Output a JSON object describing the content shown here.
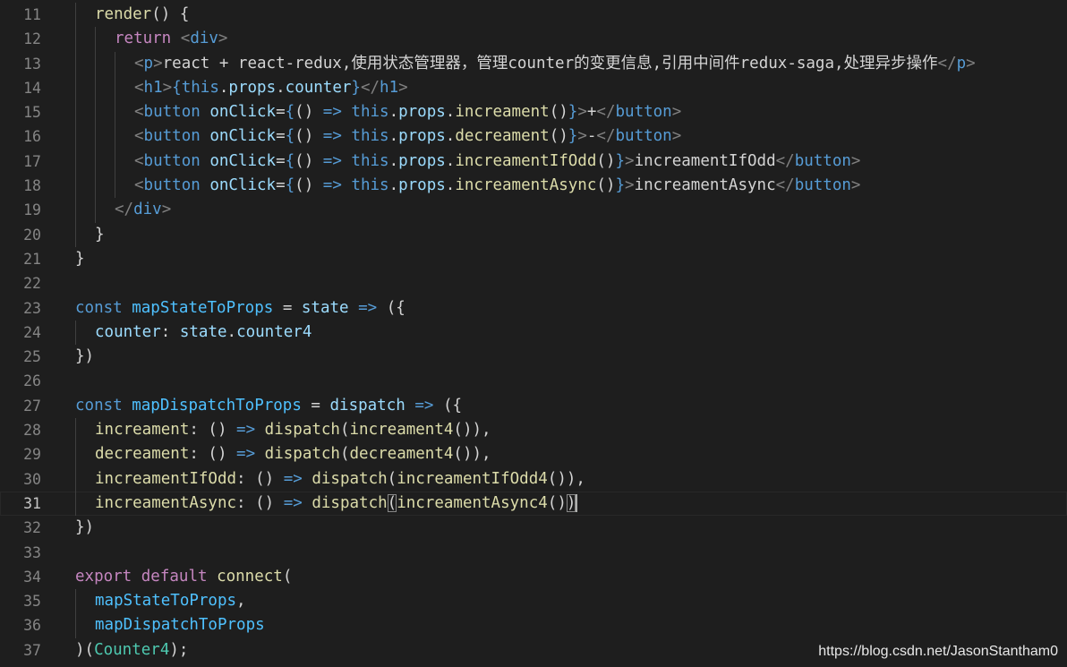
{
  "editor": {
    "lines": [
      {
        "n": "11",
        "indent": 1,
        "tokens": [
          [
            "fn",
            "render"
          ],
          [
            "op",
            "() {"
          ]
        ]
      },
      {
        "n": "12",
        "indent": 2,
        "tokens": [
          [
            "kw",
            "return"
          ],
          [
            "op",
            " "
          ],
          [
            "br",
            "<"
          ],
          [
            "tag",
            "div"
          ],
          [
            "br",
            ">"
          ]
        ]
      },
      {
        "n": "13",
        "indent": 3,
        "tokens": [
          [
            "br",
            "<"
          ],
          [
            "tag",
            "p"
          ],
          [
            "br",
            ">"
          ],
          [
            "txt",
            "react + react-redux,使用状态管理器，管理counter的变更信息,引用中间件redux-saga,处理异步操作"
          ],
          [
            "br",
            "</"
          ],
          [
            "tag",
            "p"
          ],
          [
            "br",
            ">"
          ]
        ]
      },
      {
        "n": "14",
        "indent": 3,
        "tokens": [
          [
            "br",
            "<"
          ],
          [
            "tag",
            "h1"
          ],
          [
            "br",
            ">"
          ],
          [
            "dk",
            "{"
          ],
          [
            "dk",
            "this"
          ],
          [
            "op",
            "."
          ],
          [
            "var",
            "props"
          ],
          [
            "op",
            "."
          ],
          [
            "var",
            "counter"
          ],
          [
            "dk",
            "}"
          ],
          [
            "br",
            "</"
          ],
          [
            "tag",
            "h1"
          ],
          [
            "br",
            ">"
          ]
        ]
      },
      {
        "n": "15",
        "indent": 3,
        "tokens": [
          [
            "br",
            "<"
          ],
          [
            "tag",
            "button"
          ],
          [
            "op",
            " "
          ],
          [
            "attr",
            "onClick"
          ],
          [
            "op",
            "="
          ],
          [
            "dk",
            "{"
          ],
          [
            "op",
            "() "
          ],
          [
            "dk",
            "=>"
          ],
          [
            "op",
            " "
          ],
          [
            "dk",
            "this"
          ],
          [
            "op",
            "."
          ],
          [
            "var",
            "props"
          ],
          [
            "op",
            "."
          ],
          [
            "fn",
            "increament"
          ],
          [
            "op",
            "()"
          ],
          [
            "dk",
            "}"
          ],
          [
            "br",
            ">"
          ],
          [
            "txt",
            "+"
          ],
          [
            "br",
            "</"
          ],
          [
            "tag",
            "button"
          ],
          [
            "br",
            ">"
          ]
        ]
      },
      {
        "n": "16",
        "indent": 3,
        "tokens": [
          [
            "br",
            "<"
          ],
          [
            "tag",
            "button"
          ],
          [
            "op",
            " "
          ],
          [
            "attr",
            "onClick"
          ],
          [
            "op",
            "="
          ],
          [
            "dk",
            "{"
          ],
          [
            "op",
            "() "
          ],
          [
            "dk",
            "=>"
          ],
          [
            "op",
            " "
          ],
          [
            "dk",
            "this"
          ],
          [
            "op",
            "."
          ],
          [
            "var",
            "props"
          ],
          [
            "op",
            "."
          ],
          [
            "fn",
            "decreament"
          ],
          [
            "op",
            "()"
          ],
          [
            "dk",
            "}"
          ],
          [
            "br",
            ">"
          ],
          [
            "txt",
            "-"
          ],
          [
            "br",
            "</"
          ],
          [
            "tag",
            "button"
          ],
          [
            "br",
            ">"
          ]
        ]
      },
      {
        "n": "17",
        "indent": 3,
        "tokens": [
          [
            "br",
            "<"
          ],
          [
            "tag",
            "button"
          ],
          [
            "op",
            " "
          ],
          [
            "attr",
            "onClick"
          ],
          [
            "op",
            "="
          ],
          [
            "dk",
            "{"
          ],
          [
            "op",
            "() "
          ],
          [
            "dk",
            "=>"
          ],
          [
            "op",
            " "
          ],
          [
            "dk",
            "this"
          ],
          [
            "op",
            "."
          ],
          [
            "var",
            "props"
          ],
          [
            "op",
            "."
          ],
          [
            "fn",
            "increamentIfOdd"
          ],
          [
            "op",
            "()"
          ],
          [
            "dk",
            "}"
          ],
          [
            "br",
            ">"
          ],
          [
            "txt",
            "increamentIfOdd"
          ],
          [
            "br",
            "</"
          ],
          [
            "tag",
            "button"
          ],
          [
            "br",
            ">"
          ]
        ]
      },
      {
        "n": "18",
        "indent": 3,
        "tokens": [
          [
            "br",
            "<"
          ],
          [
            "tag",
            "button"
          ],
          [
            "op",
            " "
          ],
          [
            "attr",
            "onClick"
          ],
          [
            "op",
            "="
          ],
          [
            "dk",
            "{"
          ],
          [
            "op",
            "() "
          ],
          [
            "dk",
            "=>"
          ],
          [
            "op",
            " "
          ],
          [
            "dk",
            "this"
          ],
          [
            "op",
            "."
          ],
          [
            "var",
            "props"
          ],
          [
            "op",
            "."
          ],
          [
            "fn",
            "increamentAsync"
          ],
          [
            "op",
            "()"
          ],
          [
            "dk",
            "}"
          ],
          [
            "br",
            ">"
          ],
          [
            "txt",
            "increamentAsync"
          ],
          [
            "br",
            "</"
          ],
          [
            "tag",
            "button"
          ],
          [
            "br",
            ">"
          ]
        ]
      },
      {
        "n": "19",
        "indent": 2,
        "tokens": [
          [
            "br",
            "</"
          ],
          [
            "tag",
            "div"
          ],
          [
            "br",
            ">"
          ]
        ]
      },
      {
        "n": "20",
        "indent": 1,
        "tokens": [
          [
            "op",
            "}"
          ]
        ]
      },
      {
        "n": "21",
        "indent": 0,
        "tokens": [
          [
            "op",
            "}"
          ]
        ]
      },
      {
        "n": "22",
        "indent": 0,
        "tokens": []
      },
      {
        "n": "23",
        "indent": 0,
        "tokens": [
          [
            "dk",
            "const"
          ],
          [
            "op",
            " "
          ],
          [
            "const",
            "mapStateToProps"
          ],
          [
            "op",
            " = "
          ],
          [
            "var",
            "state"
          ],
          [
            "op",
            " "
          ],
          [
            "dk",
            "=>"
          ],
          [
            "op",
            " ({"
          ]
        ]
      },
      {
        "n": "24",
        "indent": 1,
        "tokens": [
          [
            "var",
            "counter"
          ],
          [
            "op",
            ": "
          ],
          [
            "var",
            "state"
          ],
          [
            "op",
            "."
          ],
          [
            "var",
            "counter4"
          ]
        ]
      },
      {
        "n": "25",
        "indent": 0,
        "tokens": [
          [
            "op",
            "})"
          ]
        ]
      },
      {
        "n": "26",
        "indent": 0,
        "tokens": []
      },
      {
        "n": "27",
        "indent": 0,
        "tokens": [
          [
            "dk",
            "const"
          ],
          [
            "op",
            " "
          ],
          [
            "const",
            "mapDispatchToProps"
          ],
          [
            "op",
            " = "
          ],
          [
            "var",
            "dispatch"
          ],
          [
            "op",
            " "
          ],
          [
            "dk",
            "=>"
          ],
          [
            "op",
            " ({"
          ]
        ]
      },
      {
        "n": "28",
        "indent": 1,
        "tokens": [
          [
            "fn",
            "increament"
          ],
          [
            "op",
            ": () "
          ],
          [
            "dk",
            "=>"
          ],
          [
            "op",
            " "
          ],
          [
            "fn",
            "dispatch"
          ],
          [
            "op",
            "("
          ],
          [
            "fn",
            "increament4"
          ],
          [
            "op",
            "()),"
          ]
        ]
      },
      {
        "n": "29",
        "indent": 1,
        "tokens": [
          [
            "fn",
            "decreament"
          ],
          [
            "op",
            ": () "
          ],
          [
            "dk",
            "=>"
          ],
          [
            "op",
            " "
          ],
          [
            "fn",
            "dispatch"
          ],
          [
            "op",
            "("
          ],
          [
            "fn",
            "decreament4"
          ],
          [
            "op",
            "()),"
          ]
        ]
      },
      {
        "n": "30",
        "indent": 1,
        "tokens": [
          [
            "fn",
            "increamentIfOdd"
          ],
          [
            "op",
            ": () "
          ],
          [
            "dk",
            "=>"
          ],
          [
            "op",
            " "
          ],
          [
            "fn",
            "dispatch"
          ],
          [
            "op",
            "("
          ],
          [
            "fn",
            "increamentIfOdd4"
          ],
          [
            "op",
            "()),"
          ]
        ]
      },
      {
        "n": "31",
        "indent": 1,
        "current": true,
        "tokens": [
          [
            "fn",
            "increamentAsync"
          ],
          [
            "op",
            ": () "
          ],
          [
            "dk",
            "=>"
          ],
          [
            "op",
            " "
          ],
          [
            "fn",
            "dispatch"
          ],
          [
            "match",
            "("
          ],
          [
            "fn",
            "increamentAsync4"
          ],
          [
            "op",
            "()"
          ],
          [
            "match",
            ")"
          ],
          [
            "cursor",
            ""
          ]
        ]
      },
      {
        "n": "32",
        "indent": 0,
        "tokens": [
          [
            "op",
            "})"
          ]
        ]
      },
      {
        "n": "33",
        "indent": 0,
        "tokens": []
      },
      {
        "n": "34",
        "indent": 0,
        "tokens": [
          [
            "kw",
            "export"
          ],
          [
            "op",
            " "
          ],
          [
            "kw",
            "default"
          ],
          [
            "op",
            " "
          ],
          [
            "fn",
            "connect"
          ],
          [
            "op",
            "("
          ]
        ]
      },
      {
        "n": "35",
        "indent": 1,
        "tokens": [
          [
            "const",
            "mapStateToProps"
          ],
          [
            "op",
            ","
          ]
        ]
      },
      {
        "n": "36",
        "indent": 1,
        "tokens": [
          [
            "const",
            "mapDispatchToProps"
          ]
        ]
      },
      {
        "n": "37",
        "indent": 0,
        "tokens": [
          [
            "op",
            ")("
          ],
          [
            "cls",
            "Counter4"
          ],
          [
            "op",
            ");"
          ]
        ]
      }
    ]
  },
  "watermark": "https://blog.csdn.net/JasonStantham0"
}
